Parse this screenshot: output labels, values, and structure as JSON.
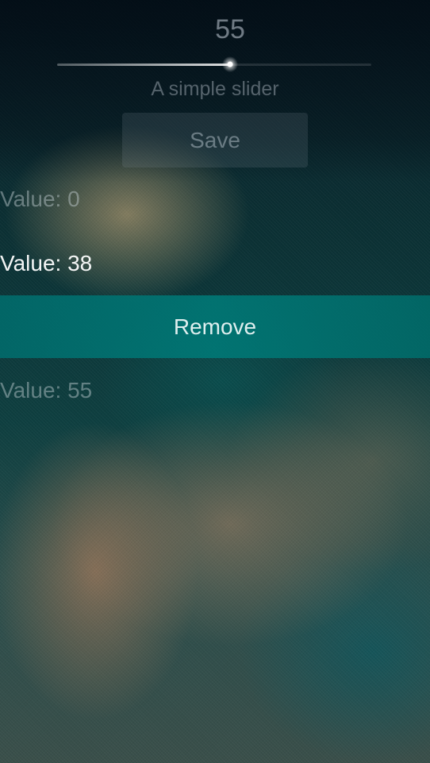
{
  "slider": {
    "value": "55",
    "level_percent": 55,
    "label": "A simple slider"
  },
  "save_button": {
    "label": "Save"
  },
  "list": {
    "items": [
      {
        "label": "Value: 0"
      },
      {
        "label": "Value: 38"
      },
      {
        "label": "Value: 55"
      }
    ],
    "remove_label": "Remove"
  },
  "colors": {
    "accent": "#007876",
    "background": "#0a2f33"
  }
}
